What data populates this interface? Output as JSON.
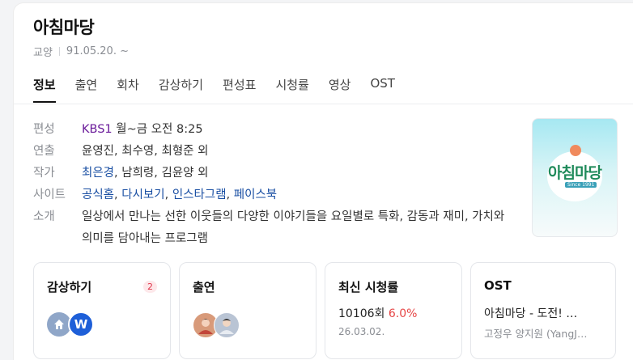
{
  "program": {
    "title": "아침마당",
    "category": "교양",
    "date": "91.05.20. ~"
  },
  "tabs": [
    "정보",
    "출연",
    "회차",
    "감상하기",
    "편성표",
    "시청률",
    "영상",
    "OST"
  ],
  "info": {
    "schedule": {
      "label": "편성",
      "channel": "KBS1",
      "time": "월~금 오전 8:25"
    },
    "director": {
      "label": "연출",
      "value": "윤영진, 최수영, 최형준 외"
    },
    "writer": {
      "label": "작가",
      "link": "최은경",
      "rest": ", 남희령, 김윤양 외"
    },
    "sites": {
      "label": "사이트",
      "links": [
        "공식홈",
        "다시보기",
        "인스타그램",
        "페이스북"
      ]
    },
    "intro": {
      "label": "소개",
      "value": "일상에서 만나는 선한 이웃들의 다양한 이야기들을 요일별로 특화, 감동과 재미, 가치와 의미를 담아내는 프로그램"
    }
  },
  "poster": {
    "logo_text": "아침마당",
    "since": "Since 1991"
  },
  "cards": {
    "watch": {
      "title": "감상하기",
      "badge": "2",
      "icons": [
        "home-icon",
        "w-icon"
      ]
    },
    "cast": {
      "title": "출연"
    },
    "rating": {
      "title": "최신 시청률",
      "episode": "10106회",
      "percent": "6.0%",
      "date": "26.03.02."
    },
    "ost": {
      "title": "OST",
      "song": "아침마당 - 도전! …",
      "artists": "고정우 양지원 (YangJ…"
    }
  },
  "colors": {
    "link": "#1a4fa3",
    "channel": "#6a1a9a",
    "rating_up": "#e64545",
    "badge": "#e0364c"
  }
}
